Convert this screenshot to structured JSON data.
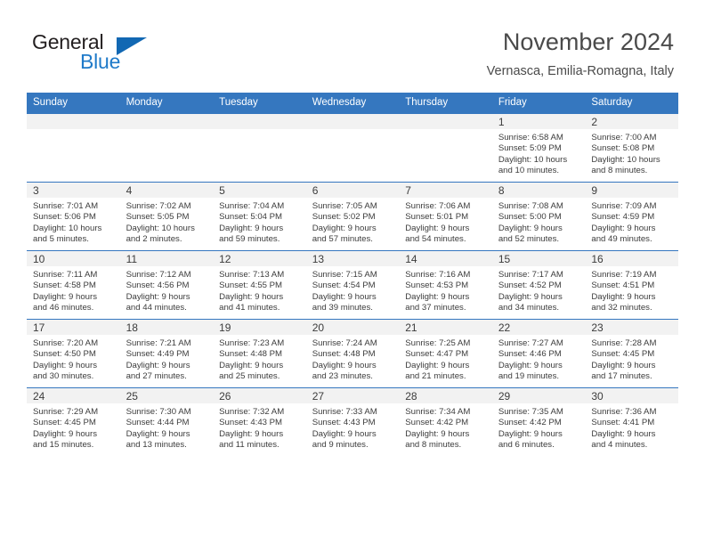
{
  "brand": {
    "name_part1": "General",
    "name_part2": "Blue",
    "triangle_icon": "brand-triangle-icon",
    "accent_color": "#1268b3"
  },
  "header": {
    "title": "November 2024",
    "subtitle": "Vernasca, Emilia-Romagna, Italy"
  },
  "theme": {
    "header_blue": "#3577bf",
    "daynum_band": "#f2f2f2",
    "text": "#3c3c3c"
  },
  "weekdays": [
    "Sunday",
    "Monday",
    "Tuesday",
    "Wednesday",
    "Thursday",
    "Friday",
    "Saturday"
  ],
  "weeks": [
    [
      {
        "day": "",
        "sunrise": "",
        "sunset": "",
        "daylight1": "",
        "daylight2": ""
      },
      {
        "day": "",
        "sunrise": "",
        "sunset": "",
        "daylight1": "",
        "daylight2": ""
      },
      {
        "day": "",
        "sunrise": "",
        "sunset": "",
        "daylight1": "",
        "daylight2": ""
      },
      {
        "day": "",
        "sunrise": "",
        "sunset": "",
        "daylight1": "",
        "daylight2": ""
      },
      {
        "day": "",
        "sunrise": "",
        "sunset": "",
        "daylight1": "",
        "daylight2": ""
      },
      {
        "day": "1",
        "sunrise": "Sunrise: 6:58 AM",
        "sunset": "Sunset: 5:09 PM",
        "daylight1": "Daylight: 10 hours",
        "daylight2": "and 10 minutes."
      },
      {
        "day": "2",
        "sunrise": "Sunrise: 7:00 AM",
        "sunset": "Sunset: 5:08 PM",
        "daylight1": "Daylight: 10 hours",
        "daylight2": "and 8 minutes."
      }
    ],
    [
      {
        "day": "3",
        "sunrise": "Sunrise: 7:01 AM",
        "sunset": "Sunset: 5:06 PM",
        "daylight1": "Daylight: 10 hours",
        "daylight2": "and 5 minutes."
      },
      {
        "day": "4",
        "sunrise": "Sunrise: 7:02 AM",
        "sunset": "Sunset: 5:05 PM",
        "daylight1": "Daylight: 10 hours",
        "daylight2": "and 2 minutes."
      },
      {
        "day": "5",
        "sunrise": "Sunrise: 7:04 AM",
        "sunset": "Sunset: 5:04 PM",
        "daylight1": "Daylight: 9 hours",
        "daylight2": "and 59 minutes."
      },
      {
        "day": "6",
        "sunrise": "Sunrise: 7:05 AM",
        "sunset": "Sunset: 5:02 PM",
        "daylight1": "Daylight: 9 hours",
        "daylight2": "and 57 minutes."
      },
      {
        "day": "7",
        "sunrise": "Sunrise: 7:06 AM",
        "sunset": "Sunset: 5:01 PM",
        "daylight1": "Daylight: 9 hours",
        "daylight2": "and 54 minutes."
      },
      {
        "day": "8",
        "sunrise": "Sunrise: 7:08 AM",
        "sunset": "Sunset: 5:00 PM",
        "daylight1": "Daylight: 9 hours",
        "daylight2": "and 52 minutes."
      },
      {
        "day": "9",
        "sunrise": "Sunrise: 7:09 AM",
        "sunset": "Sunset: 4:59 PM",
        "daylight1": "Daylight: 9 hours",
        "daylight2": "and 49 minutes."
      }
    ],
    [
      {
        "day": "10",
        "sunrise": "Sunrise: 7:11 AM",
        "sunset": "Sunset: 4:58 PM",
        "daylight1": "Daylight: 9 hours",
        "daylight2": "and 46 minutes."
      },
      {
        "day": "11",
        "sunrise": "Sunrise: 7:12 AM",
        "sunset": "Sunset: 4:56 PM",
        "daylight1": "Daylight: 9 hours",
        "daylight2": "and 44 minutes."
      },
      {
        "day": "12",
        "sunrise": "Sunrise: 7:13 AM",
        "sunset": "Sunset: 4:55 PM",
        "daylight1": "Daylight: 9 hours",
        "daylight2": "and 41 minutes."
      },
      {
        "day": "13",
        "sunrise": "Sunrise: 7:15 AM",
        "sunset": "Sunset: 4:54 PM",
        "daylight1": "Daylight: 9 hours",
        "daylight2": "and 39 minutes."
      },
      {
        "day": "14",
        "sunrise": "Sunrise: 7:16 AM",
        "sunset": "Sunset: 4:53 PM",
        "daylight1": "Daylight: 9 hours",
        "daylight2": "and 37 minutes."
      },
      {
        "day": "15",
        "sunrise": "Sunrise: 7:17 AM",
        "sunset": "Sunset: 4:52 PM",
        "daylight1": "Daylight: 9 hours",
        "daylight2": "and 34 minutes."
      },
      {
        "day": "16",
        "sunrise": "Sunrise: 7:19 AM",
        "sunset": "Sunset: 4:51 PM",
        "daylight1": "Daylight: 9 hours",
        "daylight2": "and 32 minutes."
      }
    ],
    [
      {
        "day": "17",
        "sunrise": "Sunrise: 7:20 AM",
        "sunset": "Sunset: 4:50 PM",
        "daylight1": "Daylight: 9 hours",
        "daylight2": "and 30 minutes."
      },
      {
        "day": "18",
        "sunrise": "Sunrise: 7:21 AM",
        "sunset": "Sunset: 4:49 PM",
        "daylight1": "Daylight: 9 hours",
        "daylight2": "and 27 minutes."
      },
      {
        "day": "19",
        "sunrise": "Sunrise: 7:23 AM",
        "sunset": "Sunset: 4:48 PM",
        "daylight1": "Daylight: 9 hours",
        "daylight2": "and 25 minutes."
      },
      {
        "day": "20",
        "sunrise": "Sunrise: 7:24 AM",
        "sunset": "Sunset: 4:48 PM",
        "daylight1": "Daylight: 9 hours",
        "daylight2": "and 23 minutes."
      },
      {
        "day": "21",
        "sunrise": "Sunrise: 7:25 AM",
        "sunset": "Sunset: 4:47 PM",
        "daylight1": "Daylight: 9 hours",
        "daylight2": "and 21 minutes."
      },
      {
        "day": "22",
        "sunrise": "Sunrise: 7:27 AM",
        "sunset": "Sunset: 4:46 PM",
        "daylight1": "Daylight: 9 hours",
        "daylight2": "and 19 minutes."
      },
      {
        "day": "23",
        "sunrise": "Sunrise: 7:28 AM",
        "sunset": "Sunset: 4:45 PM",
        "daylight1": "Daylight: 9 hours",
        "daylight2": "and 17 minutes."
      }
    ],
    [
      {
        "day": "24",
        "sunrise": "Sunrise: 7:29 AM",
        "sunset": "Sunset: 4:45 PM",
        "daylight1": "Daylight: 9 hours",
        "daylight2": "and 15 minutes."
      },
      {
        "day": "25",
        "sunrise": "Sunrise: 7:30 AM",
        "sunset": "Sunset: 4:44 PM",
        "daylight1": "Daylight: 9 hours",
        "daylight2": "and 13 minutes."
      },
      {
        "day": "26",
        "sunrise": "Sunrise: 7:32 AM",
        "sunset": "Sunset: 4:43 PM",
        "daylight1": "Daylight: 9 hours",
        "daylight2": "and 11 minutes."
      },
      {
        "day": "27",
        "sunrise": "Sunrise: 7:33 AM",
        "sunset": "Sunset: 4:43 PM",
        "daylight1": "Daylight: 9 hours",
        "daylight2": "and 9 minutes."
      },
      {
        "day": "28",
        "sunrise": "Sunrise: 7:34 AM",
        "sunset": "Sunset: 4:42 PM",
        "daylight1": "Daylight: 9 hours",
        "daylight2": "and 8 minutes."
      },
      {
        "day": "29",
        "sunrise": "Sunrise: 7:35 AM",
        "sunset": "Sunset: 4:42 PM",
        "daylight1": "Daylight: 9 hours",
        "daylight2": "and 6 minutes."
      },
      {
        "day": "30",
        "sunrise": "Sunrise: 7:36 AM",
        "sunset": "Sunset: 4:41 PM",
        "daylight1": "Daylight: 9 hours",
        "daylight2": "and 4 minutes."
      }
    ]
  ]
}
